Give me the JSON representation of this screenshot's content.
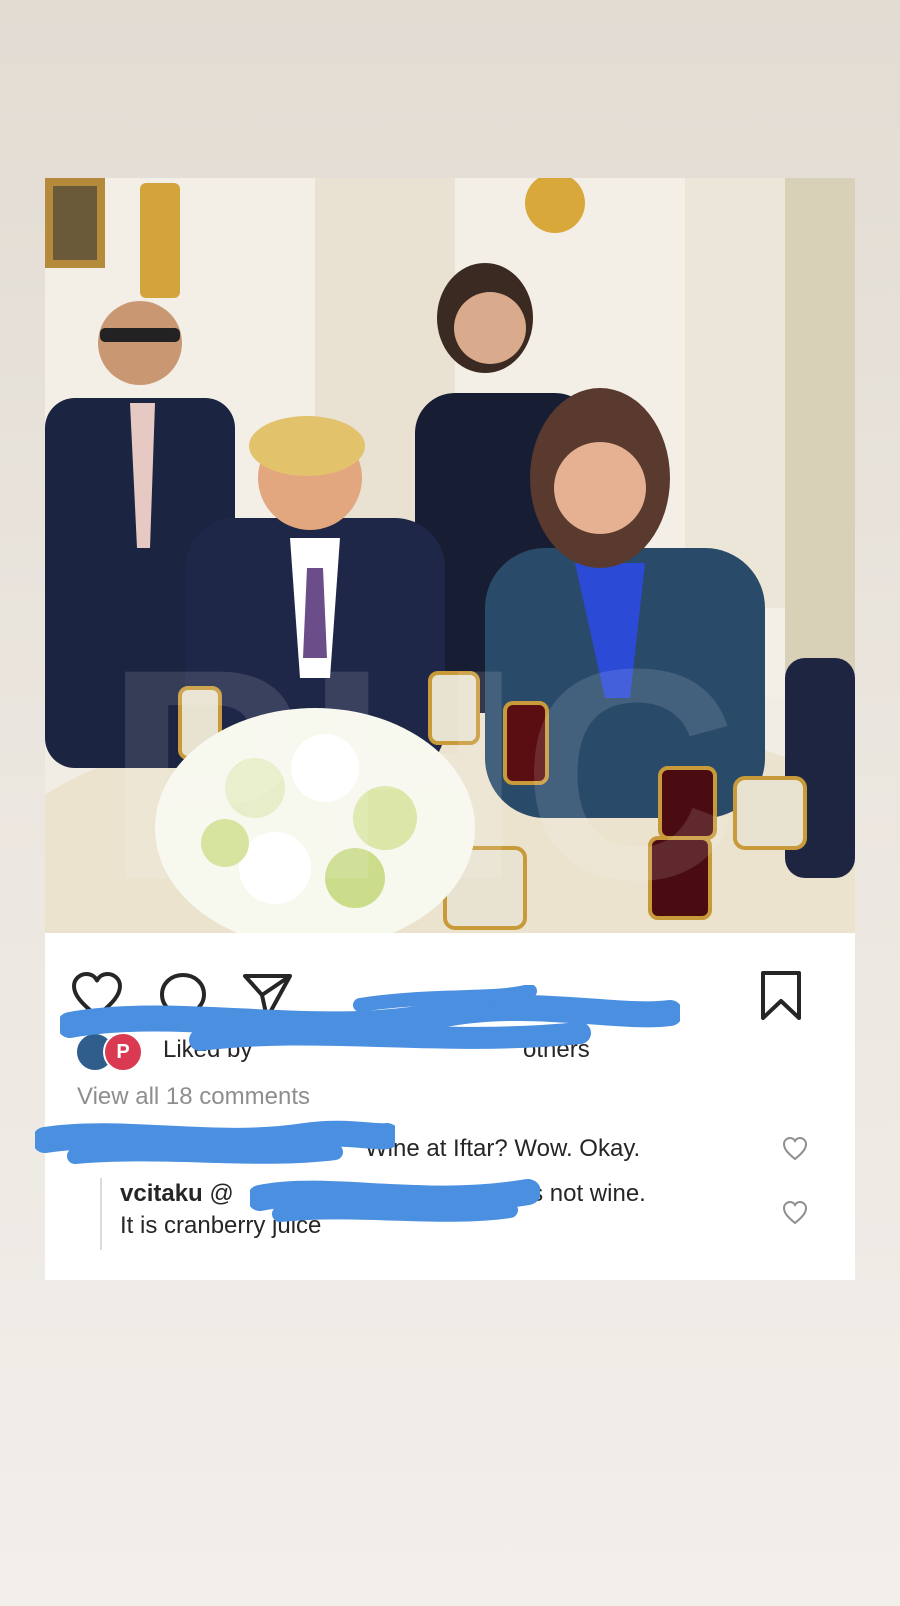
{
  "post": {
    "likes_prefix": "Liked by",
    "likes_suffix": "others",
    "view_all": "View all 18 comments",
    "avatar_letter": "P",
    "comments": [
      {
        "text": "Wine at Iftar? Wow. Okay."
      },
      {
        "user": "vcitaku",
        "mention_prefix": "@",
        "text_end": "it is not wine.",
        "line2": "It is cranberry juice"
      }
    ]
  },
  "icons": {
    "like": "heart-icon",
    "comment": "comment-bubble-icon",
    "share": "paper-plane-icon",
    "save": "bookmark-icon"
  },
  "colors": {
    "redaction": "#4a8fe0",
    "text": "#262626",
    "muted": "#8e8e8e"
  }
}
